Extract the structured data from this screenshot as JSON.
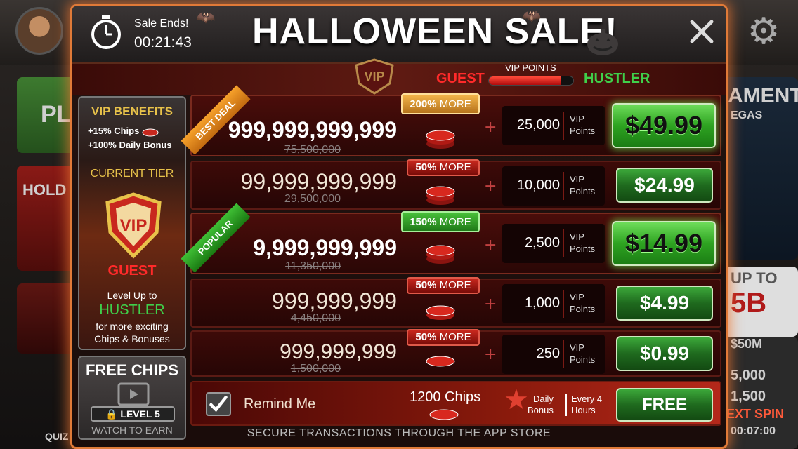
{
  "background": {
    "left_tiles": [
      "PL",
      "HOLD"
    ],
    "right_text": [
      "AMENT",
      "EGAS",
      "UP TO",
      "5B",
      "$50M",
      "5,000",
      "1,500",
      "EXT SPIN",
      "00:07:00"
    ],
    "quiz_label": "QUIZ"
  },
  "header": {
    "sale_ends_label": "Sale Ends!",
    "timer": "00:21:43",
    "title": "HALLOWEEN SALE!"
  },
  "vip_progress": {
    "current_tier": "GUEST",
    "next_tier": "HUSTLER",
    "label": "VIP POINTS",
    "progress_fraction": 0.85,
    "badge_text": "VIP"
  },
  "sidebar": {
    "title": "VIP BENEFITS",
    "benefit_1": "+15% Chips",
    "benefit_2": "+100% Daily Bonus",
    "current_tier_label": "CURRENT TIER",
    "shield_text": "VIP",
    "tier_name": "GUEST",
    "level_up_text": "Level Up to",
    "next_tier": "HUSTLER",
    "more_text_1": "for more exciting",
    "more_text_2": "Chips & Bonuses"
  },
  "free_chips": {
    "title": "FREE CHIPS",
    "level_label": "LEVEL 5",
    "watch_label": "WATCH TO EARN"
  },
  "offers": [
    {
      "ribbon": "BEST DEAL",
      "more_pct": "200%",
      "more_word": "MORE",
      "chips": "999,999,999,999",
      "old_chips": "75,500,000",
      "vip_points": "25,000",
      "vip_unit_1": "VIP",
      "vip_unit_2": "Points",
      "price": "$49.99"
    },
    {
      "ribbon": "",
      "more_pct": "50%",
      "more_word": "MORE",
      "chips": "99,999,999,999",
      "old_chips": "29,500,000",
      "vip_points": "10,000",
      "vip_unit_1": "VIP",
      "vip_unit_2": "Points",
      "price": "$24.99"
    },
    {
      "ribbon": "POPULAR",
      "more_pct": "150%",
      "more_word": "MORE",
      "chips": "9,999,999,999",
      "old_chips": "11,350,000",
      "vip_points": "2,500",
      "vip_unit_1": "VIP",
      "vip_unit_2": "Points",
      "price": "$14.99"
    },
    {
      "ribbon": "",
      "more_pct": "50%",
      "more_word": "MORE",
      "chips": "999,999,999",
      "old_chips": "4,450,000",
      "vip_points": "1,000",
      "vip_unit_1": "VIP",
      "vip_unit_2": "Points",
      "price": "$4.99"
    },
    {
      "ribbon": "",
      "more_pct": "50%",
      "more_word": "MORE",
      "chips": "999,999,999",
      "old_chips": "1,500,000",
      "vip_points": "250",
      "vip_unit_1": "VIP",
      "vip_unit_2": "Points",
      "price": "$0.99"
    }
  ],
  "plus_sign": "+",
  "remind": {
    "checked": true,
    "label": "Remind Me",
    "chips": "1200 Chips",
    "daily_1": "Daily",
    "daily_2": "Bonus",
    "every_1": "Every 4",
    "every_2": "Hours",
    "button": "FREE"
  },
  "footer": "SECURE TRANSACTIONS THROUGH THE APP STORE",
  "colors": {
    "accent_orange": "#e07a38",
    "guest_red": "#ff2a2a",
    "hustler_green": "#3fd04a",
    "gold": "#e8c24a"
  }
}
